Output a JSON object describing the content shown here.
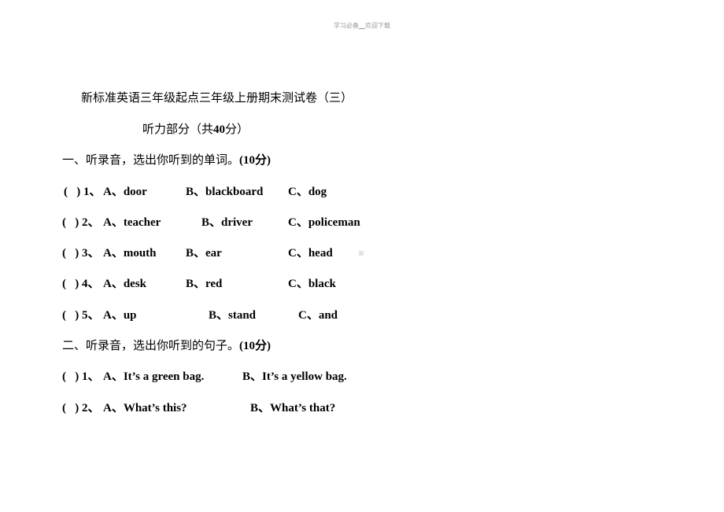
{
  "header": {
    "text": "学习必备",
    "sep": "__",
    "text2": "欢迎下载"
  },
  "title": "新标准英语三年级起点三年级上册期末测试卷（三）",
  "subtitle": {
    "cn": "听力部分（共",
    "num": "40",
    "cn2": "分）"
  },
  "section1": {
    "heading_cn": "一、听录音，选出你听到的单词。",
    "heading_score": "(10分)",
    "questions": [
      {
        "prefix": "(   ) 1、",
        "a": "A、door",
        "b": "B、blackboard",
        "c": "C、dog"
      },
      {
        "prefix": "(   ) 2、",
        "a": "A、teacher",
        "b": "B、driver",
        "c": "C、policeman"
      },
      {
        "prefix": "(   ) 3、",
        "a": "A、mouth",
        "b": "B、ear",
        "c": "C、head"
      },
      {
        "prefix": "(   ) 4、",
        "a": "A、desk",
        "b": "B、red",
        "c": "C、black"
      },
      {
        "prefix": "(   ) 5、",
        "a": "A、up",
        "b": "B、stand",
        "c": "C、and"
      }
    ]
  },
  "section2": {
    "heading_cn": "二、听录音，选出你听到的句子。",
    "heading_score": "(10分)",
    "questions": [
      {
        "prefix": "(   ) 1、",
        "a": "A、It’s a green bag.",
        "b": "B、It’s a yellow bag."
      },
      {
        "prefix": "(   ) 2、",
        "a": "A、What’s this?",
        "b": "B、What’s that?"
      }
    ]
  }
}
